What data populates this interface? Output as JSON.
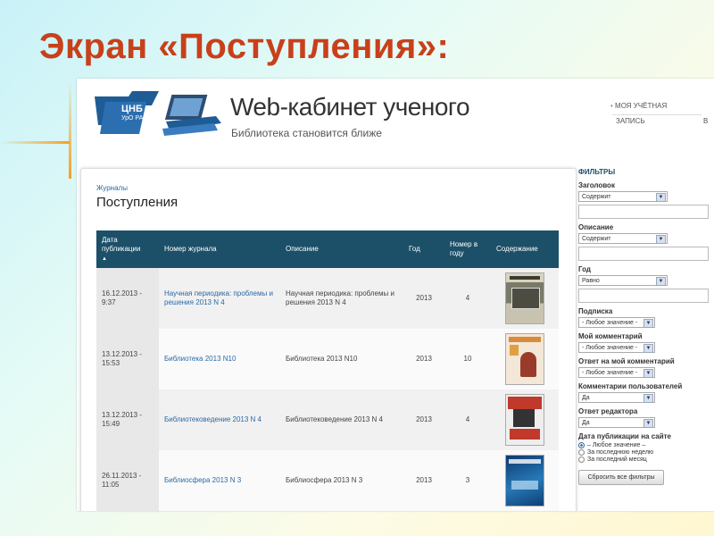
{
  "slide": {
    "title": "Экран «Поступления»:"
  },
  "logo": {
    "line1": "ЦНБ",
    "line2": "УрО РАН"
  },
  "site": {
    "title": "Web-кабинет ученого",
    "subtitle": "Библиотека становится ближе"
  },
  "account": {
    "line1": "МОЯ УЧЁТНАЯ",
    "line2": "ЗАПИСЬ",
    "cut": "В"
  },
  "breadcrumb": "Журналы",
  "page_title": "Поступления",
  "table": {
    "headers": {
      "date": "Дата публикации",
      "journal": "Номер журнала",
      "desc": "Описание",
      "year": "Год",
      "num": "Номер в году",
      "content": "Содержание"
    },
    "rows": [
      {
        "date": "16.12.2013 - 9:37",
        "journal": "Научная периодика: проблемы и решения 2013 N 4",
        "desc": "Научная периодика: проблемы и решения 2013 N 4",
        "year": "2013",
        "num": "4"
      },
      {
        "date": "13.12.2013 - 15:53",
        "journal": "Библиотека 2013 N10",
        "desc": "Библиотека 2013 N10",
        "year": "2013",
        "num": "10"
      },
      {
        "date": "13.12.2013 - 15:49",
        "journal": "Библиотековедение 2013 N 4",
        "desc": "Библиотековедение 2013 N 4",
        "year": "2013",
        "num": "4"
      },
      {
        "date": "26.11.2013 - 11:05",
        "journal": "Библиосфера 2013 N 3",
        "desc": "Библиосфера 2013 N 3",
        "year": "2013",
        "num": "3"
      }
    ]
  },
  "filters": {
    "title": "ФИЛЬТРЫ",
    "heading_label": "Заголовок",
    "heading_op": "Содержит",
    "desc_label": "Описание",
    "desc_op": "Содержит",
    "year_label": "Год",
    "year_op": "Равно",
    "sub_label": "Подписка",
    "sub_val": "- Любое значение -",
    "mycom_label": "Мой комментарий",
    "mycom_val": "- Любое значение -",
    "reply_label": "Ответ на мой комментарий",
    "reply_val": "- Любое значение -",
    "usercom_label": "Комментарии пользователей",
    "usercom_val": "Да",
    "editor_label": "Ответ редактора",
    "editor_val": "Да",
    "date_label": "Дата публикации на сайте",
    "date_opts": [
      "– Любое значение –",
      "За последнюю неделю",
      "За последний месяц"
    ],
    "reset": "Сбросить все фильтры"
  }
}
